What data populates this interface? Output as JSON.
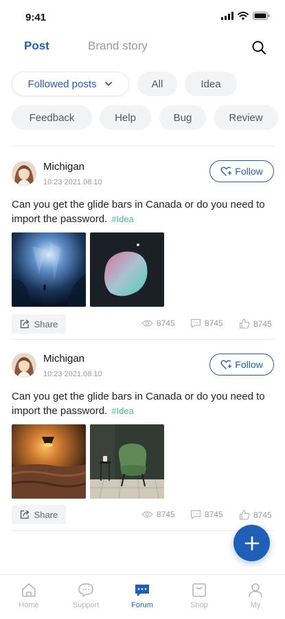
{
  "status_bar": {
    "time": "9:41"
  },
  "tabs": {
    "post": "Post",
    "brand_story": "Brand story"
  },
  "filters": {
    "followed": "Followed posts",
    "all": "All",
    "idea": "Idea",
    "feedback": "Feedback",
    "help": "Help",
    "bug": "Bug",
    "review": "Review"
  },
  "posts": [
    {
      "author": "Michigan",
      "date": "10:23  2021.08.10",
      "follow_label": "Follow",
      "text": "Can you get the glide bars in Canada or do you need to import the password.",
      "tag": "#Idea",
      "share_label": "Share",
      "views": "8745",
      "comments": "8745",
      "likes": "8745"
    },
    {
      "author": "Michigan",
      "date": "10:23  2021.08.10",
      "follow_label": "Follow",
      "text": "Can you get the glide bars in Canada or do you need to import the password.",
      "tag": "#Idea",
      "share_label": "Share",
      "views": "8745",
      "comments": "8745",
      "likes": "8745"
    }
  ],
  "bottom_nav": {
    "home": "Home",
    "support": "Support",
    "forum": "Forum",
    "shop": "Shop",
    "my": "My"
  },
  "colors": {
    "accent": "#1f5fb8",
    "tag": "#3fbf8a",
    "chip_bg": "#f1f3f5",
    "muted": "#9a9a9a"
  },
  "icons": [
    "signal-icon",
    "wifi-icon",
    "battery-icon",
    "search-icon",
    "chevron-down-icon",
    "heart-plus-icon",
    "share-icon",
    "eye-icon",
    "comment-icon",
    "thumb-up-icon",
    "plus-icon",
    "home-icon",
    "support-icon",
    "forum-icon",
    "shop-icon",
    "user-icon"
  ]
}
